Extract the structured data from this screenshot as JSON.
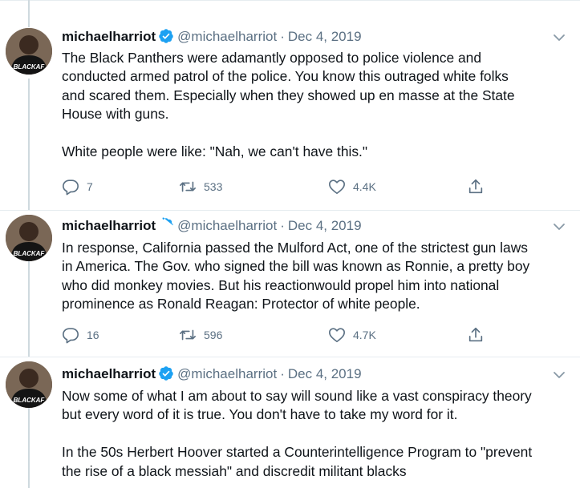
{
  "tweets": [
    {
      "display_name": "michaelharriot",
      "handle": "@michaelharriot",
      "separator": "·",
      "date": "Dec 4, 2019",
      "avatar_text": "BLACKAF",
      "lines": [
        "The Black Panthers were adamantly opposed to police violence and",
        "conducted armed patrol of the police. You know this outraged white folks",
        "and scared them. Especially when they showed up en masse at the State",
        "House with guns.",
        "",
        "White people were like: \"Nah, we can't have this.\""
      ],
      "replies": "7",
      "retweets": "533",
      "likes": "4.4K"
    },
    {
      "display_name": "michaelharriot",
      "handle": "@michaelharriot",
      "separator": "·",
      "date": "Dec 4, 2019",
      "avatar_text": "BLACKAF",
      "lines": [
        "In response, California passed the Mulford Act, one of the strictest gun laws",
        "in America. The Gov. who signed the bill was known as Ronnie, a pretty boy",
        "who did monkey movies. But his reactionwould propel him into national",
        "prominence as Ronald Reagan: Protector of white people."
      ],
      "replies": "16",
      "retweets": "596",
      "likes": "4.7K"
    },
    {
      "display_name": "michaelharriot",
      "handle": "@michaelharriot",
      "separator": "·",
      "date": "Dec 4, 2019",
      "avatar_text": "BLACKAF",
      "lines": [
        "Now some of what I am about to say will sound like a vast conspiracy theory",
        "but every word of it is true. You don't have to take my word for it.",
        "",
        "In the 50s Herbert Hoover started a Counterintelligence Program to \"prevent",
        "the rise of a black messiah\" and discredit militant blacks"
      ]
    }
  ],
  "colors": {
    "text": "#0f1419",
    "secondary": "#5b7083",
    "verified": "#1da1f2",
    "thread_line": "#cfd9de",
    "divider": "#e6ecf0"
  },
  "icons": [
    "reply-icon",
    "retweet-icon",
    "like-icon",
    "share-icon",
    "verified-badge-icon",
    "chevron-down-icon"
  ]
}
